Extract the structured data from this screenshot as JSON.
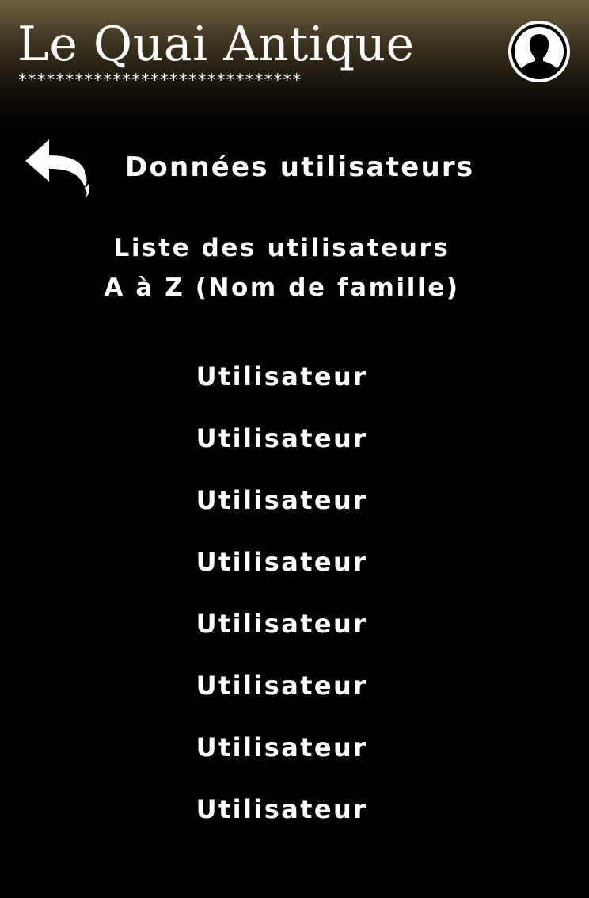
{
  "header": {
    "brand_title": "Le Quai Antique",
    "brand_stars": "******************************",
    "profile_icon": "user-avatar-icon",
    "background_colors": [
      "#6e5f3f",
      "#000000"
    ]
  },
  "page": {
    "back_icon": "reply-arrow-icon",
    "section_title": "Données utilisateurs",
    "list_heading_line1": "Liste des utilisateurs",
    "list_heading_line2": "A à Z (Nom de famille)"
  },
  "users": [
    {
      "label": "Utilisateur"
    },
    {
      "label": "Utilisateur"
    },
    {
      "label": "Utilisateur"
    },
    {
      "label": "Utilisateur"
    },
    {
      "label": "Utilisateur"
    },
    {
      "label": "Utilisateur"
    },
    {
      "label": "Utilisateur"
    },
    {
      "label": "Utilisateur"
    }
  ],
  "colors": {
    "background": "#000000",
    "text": "#ffffff"
  }
}
